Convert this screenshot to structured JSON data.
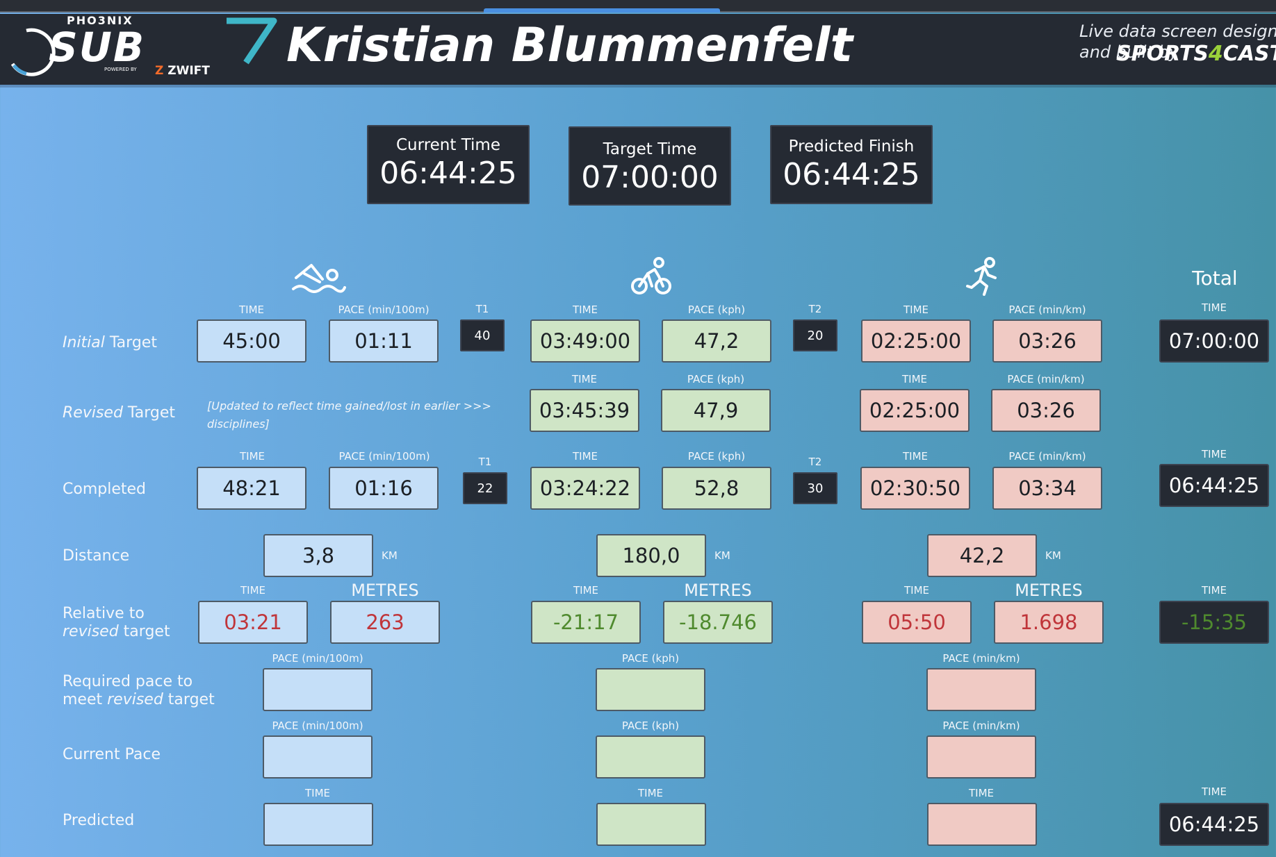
{
  "header": {
    "logo_top": "PHO3NIX",
    "logo_word": "SUB",
    "logo_powered": "POWERED BY",
    "logo_zwift": "ZWIFT",
    "athlete": "Kristian Blummenfelt",
    "credit_line1": "Live data screen designed",
    "credit_line2": "and built by",
    "credit_brand_a": "SPORTS",
    "credit_brand_b": "4",
    "credit_brand_c": "CAST"
  },
  "summary": {
    "current_label": "Current Time",
    "current_value": "06:44:25",
    "target_label": "Target Time",
    "target_value": "07:00:00",
    "predicted_label": "Predicted Finish",
    "predicted_value": "06:44:25"
  },
  "icons": {
    "swim": "swimmer-icon",
    "bike": "cyclist-icon",
    "run": "runner-icon"
  },
  "total_label": "Total",
  "labels": {
    "time": "TIME",
    "pace_swim": "PACE (min/100m)",
    "pace_bike": "PACE (kph)",
    "pace_run": "PACE (min/km)",
    "t1": "T1",
    "t2": "T2",
    "km": "KM",
    "metres": "METRES"
  },
  "rows": {
    "initial": {
      "label_em": "Initial",
      "label_rest": " Target"
    },
    "revised": {
      "label_em": "Revised",
      "label_rest": " Target",
      "note": "[Updated to reflect time gained/lost in earlier  >>> disciplines]"
    },
    "completed": {
      "label": "Completed"
    },
    "distance": {
      "label": "Distance"
    },
    "relative": {
      "label_line1": "Relative to",
      "label_em": "revised",
      "label_rest": " target"
    },
    "required": {
      "label_line1": "Required pace to",
      "label_line2a": "meet ",
      "label_em": "revised",
      "label_line2b": " target"
    },
    "current_pace": {
      "label": "Current Pace"
    },
    "predicted": {
      "label": "Predicted"
    }
  },
  "initial": {
    "swim_time": "45:00",
    "swim_pace": "01:11",
    "t1": "40",
    "bike_time": "03:49:00",
    "bike_pace": "47,2",
    "t2": "20",
    "run_time": "02:25:00",
    "run_pace": "03:26",
    "total": "07:00:00"
  },
  "revised": {
    "bike_time": "03:45:39",
    "bike_pace": "47,9",
    "run_time": "02:25:00",
    "run_pace": "03:26"
  },
  "completed": {
    "swim_time": "48:21",
    "swim_pace": "01:16",
    "t1": "22",
    "bike_time": "03:24:22",
    "bike_pace": "52,8",
    "t2": "30",
    "run_time": "02:30:50",
    "run_pace": "03:34",
    "total": "06:44:25"
  },
  "distance": {
    "swim": "3,8",
    "bike": "180,0",
    "run": "42,2"
  },
  "relative": {
    "swim_time": "03:21",
    "swim_metres": "263",
    "bike_time": "-21:17",
    "bike_metres": "-18.746",
    "run_time": "05:50",
    "run_metres": "1.698",
    "total": "-15:35"
  },
  "required": {
    "swim": "",
    "bike": "",
    "run": ""
  },
  "current_pace": {
    "swim": "",
    "bike": "",
    "run": ""
  },
  "predicted": {
    "swim": "",
    "bike": "",
    "run": "",
    "total": "06:44:25"
  },
  "colors": {
    "swim": "#c5dff8",
    "bike": "#cfe5c6",
    "run": "#f0cac4",
    "dark": "#252a33",
    "negative_red": "#c0353a",
    "positive_green": "#4f8a2e"
  }
}
